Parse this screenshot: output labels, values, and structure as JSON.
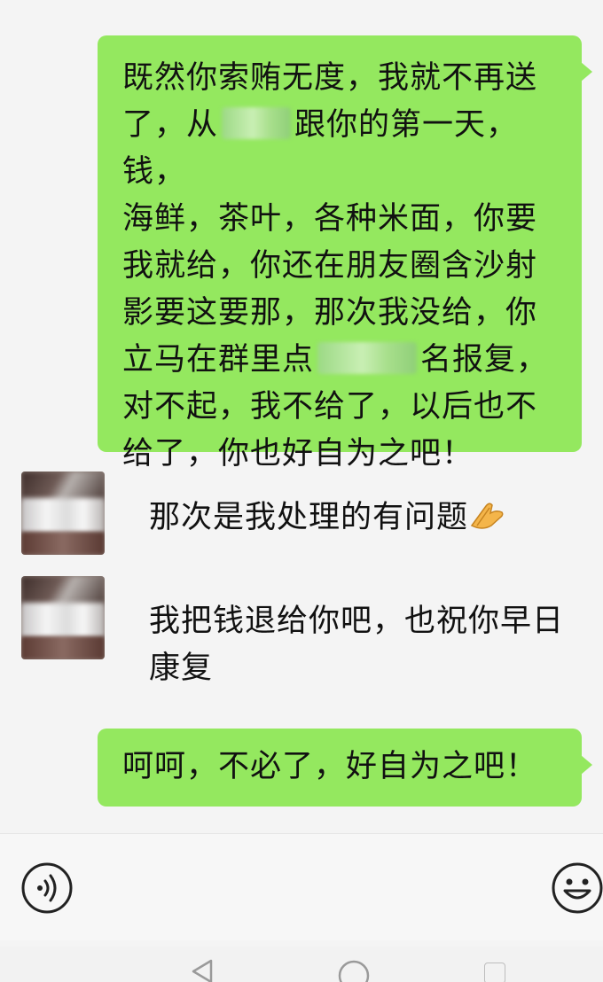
{
  "messages": {
    "outgoing_1": {
      "line1": "既然你索贿无度，我就不再送",
      "line2_a": "了，从",
      "line2_b": "跟你的第一天，钱，",
      "line3": "海鲜，茶叶，各种米面，你要",
      "line4": "我就给，你还在朋友圈含沙射",
      "line5": "影要这要那，那次我没给，你",
      "line6_a": "立马在群里点",
      "line6_b": "名报复，",
      "line7": "对不起，我不给了，以后也不",
      "line8": "给了，你也好自为之吧！"
    },
    "incoming_1": {
      "text": "那次是我处理的有问题"
    },
    "incoming_2": {
      "line1": "我把钱退给你吧，也祝你早日",
      "line2": "康复"
    },
    "outgoing_2": {
      "text": "呵呵，不必了，好自为之吧！"
    }
  },
  "icons": {
    "voice": "voice-icon",
    "emoji": "emoji-icon",
    "back": "back-icon",
    "home": "home-icon",
    "folded_hands": "folded-hands-icon"
  },
  "colors": {
    "outgoing_bubble": "#94e85f",
    "background": "#f4f4f4"
  }
}
